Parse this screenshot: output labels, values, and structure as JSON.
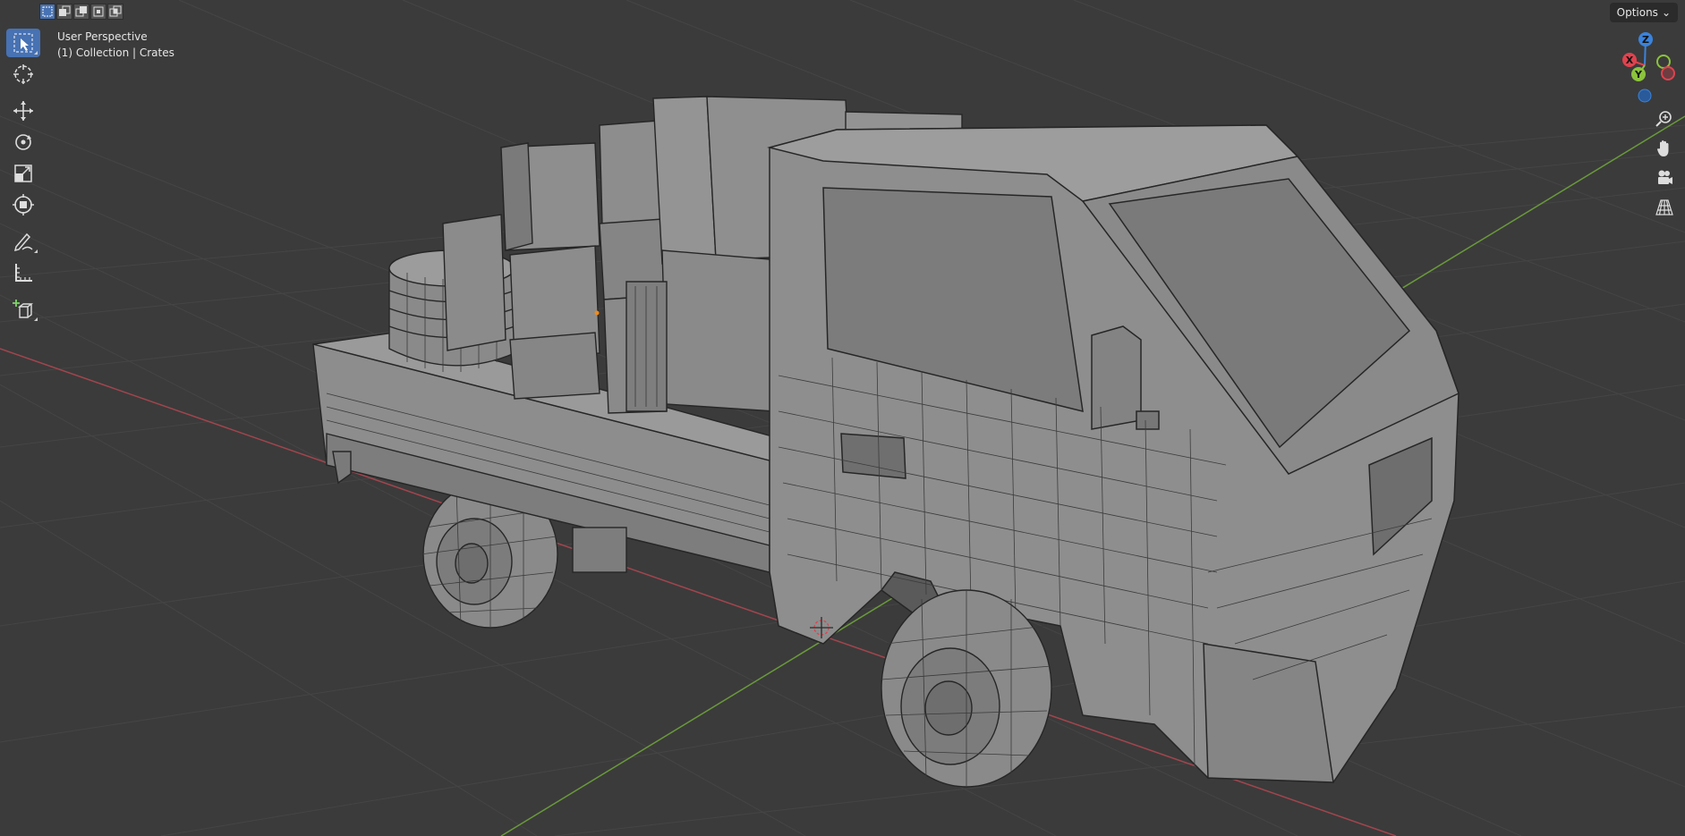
{
  "viewport": {
    "view_name": "User Perspective",
    "collection_info": "(1) Collection | Crates"
  },
  "header": {
    "options_label": "Options",
    "select_modes": [
      "select-new-icon",
      "select-extend-icon",
      "select-subtract-icon",
      "select-invert-icon",
      "select-intersect-icon"
    ]
  },
  "toolbar": {
    "tools": [
      "select-box-icon",
      "cursor-icon",
      "move-icon",
      "rotate-icon",
      "scale-icon",
      "transform-icon",
      "annotate-icon",
      "measure-icon",
      "add-cube-icon"
    ],
    "active_tool": "select-box-icon"
  },
  "gizmo": {
    "axes": [
      "X",
      "Y",
      "Z"
    ],
    "colors": {
      "x": "#e0424e",
      "y": "#8bc33c",
      "z": "#3a83dc"
    }
  },
  "nav_icons": [
    "zoom-icon",
    "pan-hand-icon",
    "camera-icon",
    "perspective-grid-icon"
  ],
  "colors": {
    "background": "#3b3b3b",
    "grid": "#454545",
    "x_axis": "#a2454e",
    "y_axis": "#6a9a3a",
    "active": "#4772b3",
    "mesh_fill": "#8e8e8e",
    "wire": "#2a2a2a"
  }
}
